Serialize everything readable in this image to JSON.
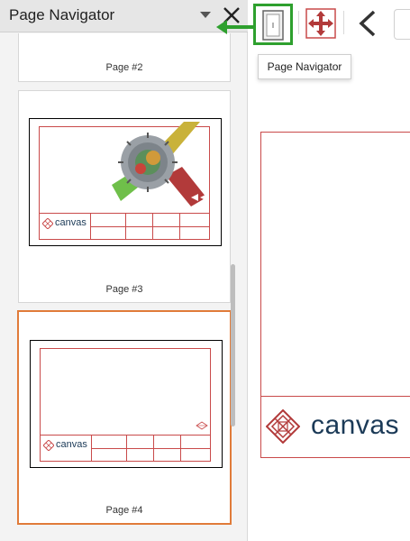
{
  "panel": {
    "title": "Page Navigator",
    "pages": [
      {
        "label": "Page #2"
      },
      {
        "label": "Page #3"
      },
      {
        "label": "Page #4"
      }
    ],
    "selected_page": "Page #4"
  },
  "thumbnail_logo": "canvas",
  "toolbar": {
    "tooltip": "Page Navigator"
  },
  "document": {
    "logo_text": "canvas"
  },
  "colors": {
    "accent_selected": "#e07b39",
    "highlight_green": "#2ea02e",
    "drawing_border": "#c94a4a",
    "logo_text": "#1b3a57"
  }
}
